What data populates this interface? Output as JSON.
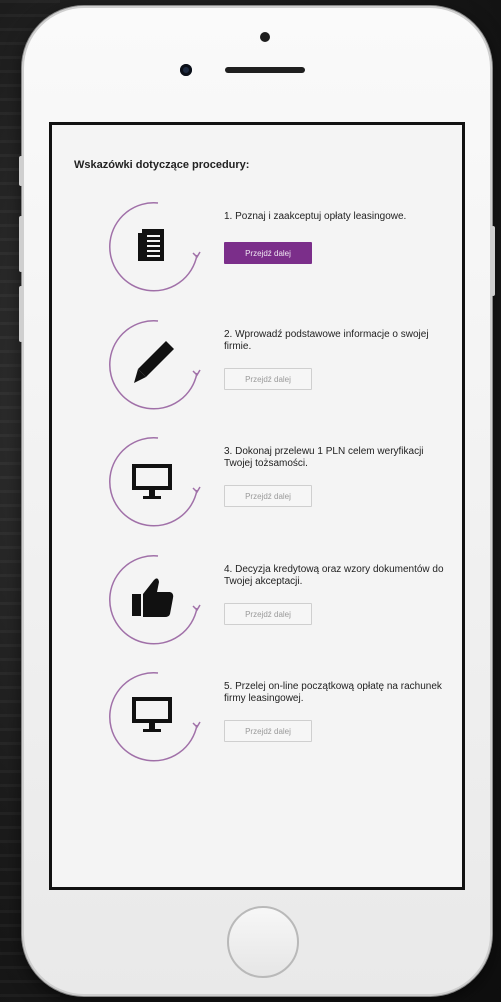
{
  "heading": "Wskazówki dotyczące procedury:",
  "steps": [
    {
      "text": "1. Poznaj i zaakceptuj opłaty leasingowe.",
      "button": "Przejdź dalej",
      "icon": "document-list-icon",
      "button_state": "active"
    },
    {
      "text": "2. Wprowadź podstawowe informacje o swojej firmie.",
      "button": "Przejdź dalej",
      "icon": "pencil-icon",
      "button_state": "disabled"
    },
    {
      "text": "3. Dokonaj przelewu 1 PLN celem weryfikacji Twojej tożsamości.",
      "button": "Przejdź dalej",
      "icon": "monitor-icon",
      "button_state": "disabled"
    },
    {
      "text": "4. Decyzja kredytową oraz wzory dokumentów do Twojej akceptacji.",
      "button": "Przejdź dalej",
      "icon": "thumbs-up-icon",
      "button_state": "disabled"
    },
    {
      "text": "5. Przelej on-line początkową opłatę na rachunek firmy leasingowej.",
      "button": "Przejdź dalej",
      "icon": "monitor-icon",
      "button_state": "disabled"
    }
  ],
  "colors": {
    "accent": "#7b2e8a",
    "ring": "#a070a8"
  }
}
